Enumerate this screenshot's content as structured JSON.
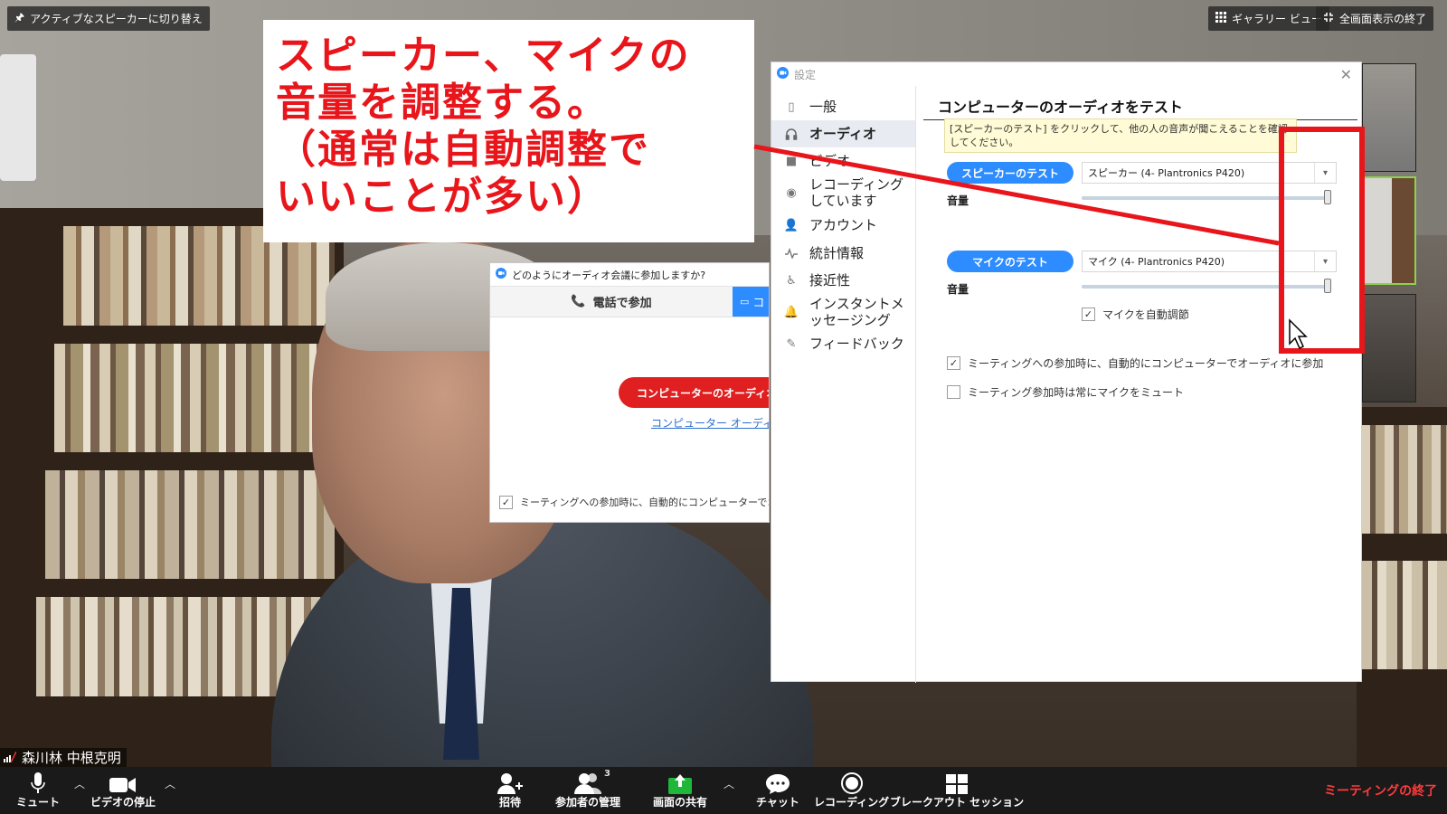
{
  "top_bar": {
    "active_speaker": "アクティブなスピーカーに切り替え",
    "gallery_view": "ギャラリー ビュー",
    "exit_fullscreen": "全画面表示の終了"
  },
  "annotation": {
    "text": "スピーカー、マイクの\n音量を調整する。\n（通常は自動調整で\nいいことが多い）"
  },
  "join_dialog": {
    "title": "どのようにオーディオ会議に参加しますか?",
    "tab_phone": "電話で参加",
    "tab_computer": "コ",
    "join_button": "コンピューターのオーディオ",
    "link": "コンピューター オーディオの",
    "auto_join": "ミーティングへの参加時に、自動的にコンピューターでオ"
  },
  "settings": {
    "title": "設定",
    "nav": [
      {
        "label": "一般",
        "icon": "phone-device-icon"
      },
      {
        "label": "オーディオ",
        "icon": "headphones-icon"
      },
      {
        "label": "ビデオ",
        "icon": "video-camera-icon"
      },
      {
        "label": "レコーディングしています",
        "icon": "record-icon"
      },
      {
        "label": "アカウント",
        "icon": "person-icon"
      },
      {
        "label": "統計情報",
        "icon": "pulse-icon"
      },
      {
        "label": "接近性",
        "icon": "accessibility-icon"
      },
      {
        "label": "インスタントメッセージング",
        "icon": "bell-icon"
      },
      {
        "label": "フィードバック",
        "icon": "feedback-icon"
      }
    ],
    "heading": "コンピューターのオーディオをテスト",
    "tooltip": "[スピーカーのテスト] をクリックして、他の人の音声が聞こえることを確認してください。",
    "speaker": {
      "button": "スピーカーのテスト",
      "device": "スピーカー (4- Plantronics P420)",
      "volume_label": "音量",
      "volume_level": 1.0
    },
    "mic": {
      "button": "マイクのテスト",
      "device": "マイク (4- Plantronics P420)",
      "volume_label": "音量",
      "volume_level": 1.0,
      "auto_adjust": "マイクを自動調節",
      "auto_adjust_checked": true
    },
    "auto_join_audio": "ミーティングへの参加時に、自動的にコンピューターでオーディオに参加",
    "auto_join_audio_checked": true,
    "mute_on_join": "ミーティング参加時は常にマイクをミュート",
    "mute_on_join_checked": false
  },
  "participant_name": "森川林 中根克明",
  "toolbar": {
    "mute": "ミュート",
    "stop_video": "ビデオの停止",
    "invite": "招待",
    "participants": "参加者の管理",
    "participants_count": "3",
    "share": "画面の共有",
    "chat": "チャット",
    "record": "レコーディング",
    "breakout": "ブレークアウト セッション",
    "end": "ミーティングの終了"
  },
  "colors": {
    "accent_blue": "#2d8cff",
    "annotation_red": "#e8151b",
    "end_red": "#ff3b3b",
    "share_green": "#1fb73a"
  }
}
